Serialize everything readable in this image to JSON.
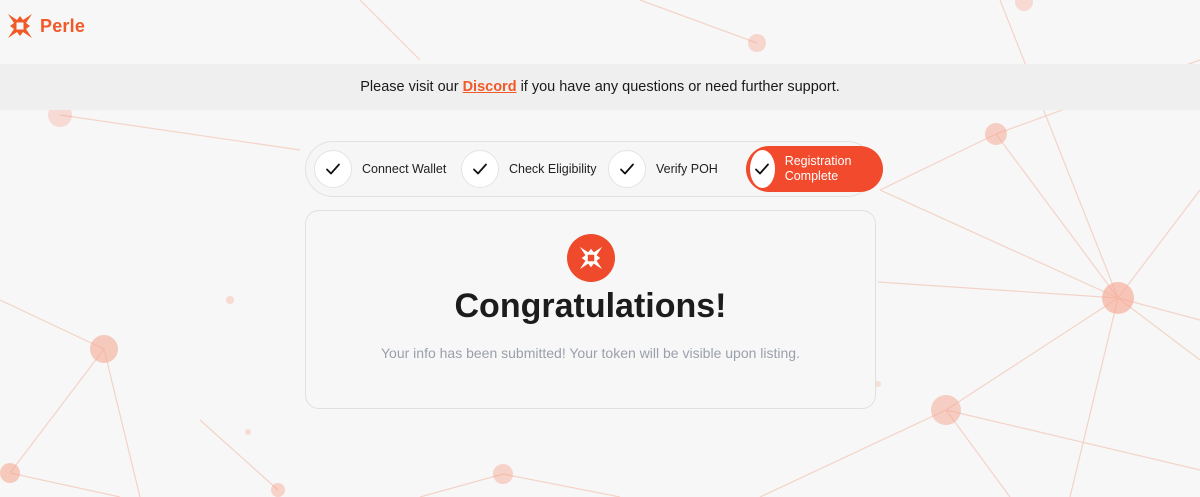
{
  "brand": {
    "name": "Perle",
    "color": "#f05a28",
    "icon": "perle-logo-icon"
  },
  "banner": {
    "prefix": "Please visit our",
    "link_label": "Discord",
    "suffix": "if you have any questions or need further support."
  },
  "steps": [
    {
      "label": "Connect Wallet",
      "completed": true,
      "active": false,
      "icon": "check-icon"
    },
    {
      "label": "Check Eligibility",
      "completed": true,
      "active": false,
      "icon": "check-icon"
    },
    {
      "label": "Verify POH",
      "completed": true,
      "active": false,
      "icon": "check-icon"
    },
    {
      "label": "Registration Complete",
      "completed": true,
      "active": true,
      "icon": "check-icon"
    }
  ],
  "card": {
    "title": "Congratulations!",
    "subtitle": "Your info has been submitted! Your token will be visible upon listing.",
    "icon": "perle-badge-icon"
  },
  "colors": {
    "accent": "#f24a2c",
    "background": "#f7f7f7",
    "network_node": "#f6a48e"
  }
}
